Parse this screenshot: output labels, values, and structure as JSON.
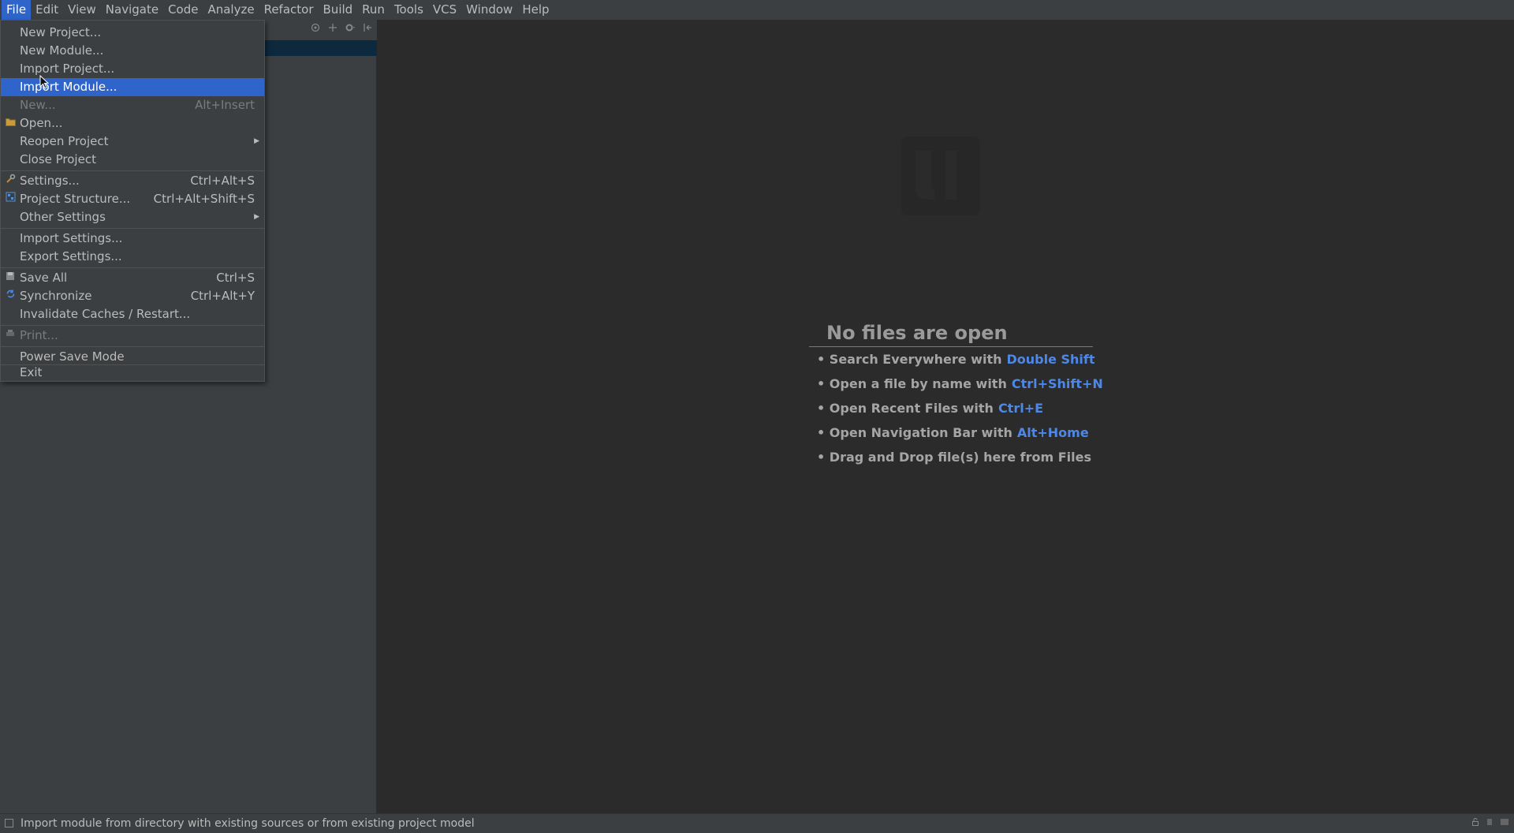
{
  "menubar": {
    "items": [
      "File",
      "Edit",
      "View",
      "Navigate",
      "Code",
      "Analyze",
      "Refactor",
      "Build",
      "Run",
      "Tools",
      "VCS",
      "Window",
      "Help"
    ]
  },
  "file_menu": {
    "items": [
      {
        "label": "New Project...",
        "shortcut": "",
        "icon": ""
      },
      {
        "label": "New Module...",
        "shortcut": "",
        "icon": ""
      },
      {
        "label": "Import Project...",
        "shortcut": "",
        "icon": ""
      },
      {
        "label": "Import Module...",
        "shortcut": "",
        "icon": "",
        "highlighted": true
      },
      {
        "label": "New...",
        "shortcut": "Alt+Insert",
        "icon": "",
        "disabled": true
      },
      {
        "label": "Open...",
        "shortcut": "",
        "icon": "folder-icon"
      },
      {
        "label": "Reopen Project",
        "shortcut": "",
        "icon": "",
        "submenu": true
      },
      {
        "label": "Close Project",
        "shortcut": "",
        "icon": ""
      },
      {
        "label": "Settings...",
        "shortcut": "Ctrl+Alt+S",
        "icon": "settings-icon"
      },
      {
        "label": "Project Structure...",
        "shortcut": "Ctrl+Alt+Shift+S",
        "icon": "project-structure-icon"
      },
      {
        "label": "Other Settings",
        "shortcut": "",
        "icon": "",
        "submenu": true
      },
      {
        "label": "Import Settings...",
        "shortcut": "",
        "icon": ""
      },
      {
        "label": "Export Settings...",
        "shortcut": "",
        "icon": ""
      },
      {
        "label": "Save All",
        "shortcut": "Ctrl+S",
        "icon": "save-icon"
      },
      {
        "label": "Synchronize",
        "shortcut": "Ctrl+Alt+Y",
        "icon": "sync-icon"
      },
      {
        "label": "Invalidate Caches / Restart...",
        "shortcut": "",
        "icon": ""
      },
      {
        "label": "Print...",
        "shortcut": "",
        "icon": "print-icon",
        "disabled": true
      },
      {
        "label": "Power Save Mode",
        "shortcut": "",
        "icon": ""
      },
      {
        "label": "Exit",
        "shortcut": "",
        "icon": ""
      }
    ]
  },
  "editor": {
    "empty_title": "No files are open",
    "hints": [
      {
        "text": "• Search Everywhere with",
        "key": "Double Shift"
      },
      {
        "text": "• Open a file by name with",
        "key": "Ctrl+Shift+N"
      },
      {
        "text": "• Open Recent Files with",
        "key": "Ctrl+E"
      },
      {
        "text": "• Open Navigation Bar with",
        "key": "Alt+Home"
      },
      {
        "text": "• Drag and Drop file(s) here from Files",
        "key": ""
      }
    ]
  },
  "statusbar": {
    "text": "Import module from directory with existing sources or from existing project model"
  },
  "colors": {
    "accent": "#2f65ca",
    "key_link": "#4e88e6",
    "background": "#2b2b2b",
    "panel": "#3c3f41"
  }
}
